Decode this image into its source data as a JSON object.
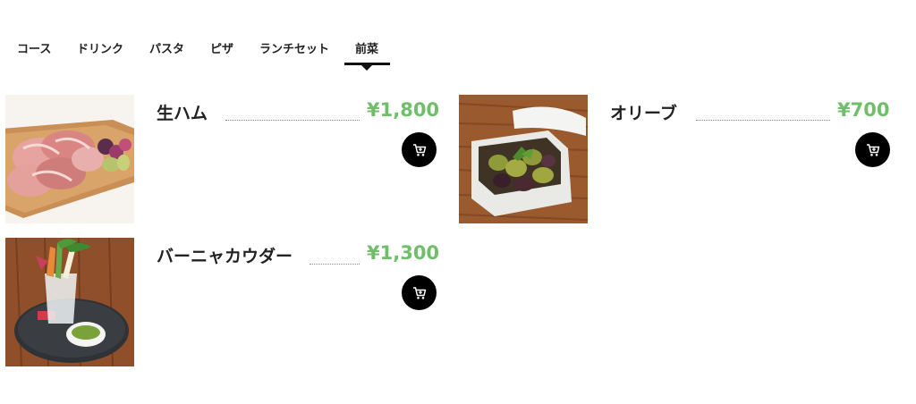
{
  "tabs": [
    {
      "label": "コース"
    },
    {
      "label": "ドリンク"
    },
    {
      "label": "パスタ"
    },
    {
      "label": "ピザ"
    },
    {
      "label": "ランチセット"
    },
    {
      "label": "前菜",
      "active": true
    }
  ],
  "items": [
    {
      "name": "生ハム",
      "price": "¥1,800",
      "image": "prosciutto-platter"
    },
    {
      "name": "オリーブ",
      "price": "¥700",
      "image": "olives-in-white-dish"
    },
    {
      "name": "バーニャカウダー",
      "price": "¥1,300",
      "image": "bagna-cauda-vegetables"
    }
  ],
  "colors": {
    "price": "#6fbf6a",
    "cart_button": "#000000",
    "active_tab": "#111111"
  }
}
